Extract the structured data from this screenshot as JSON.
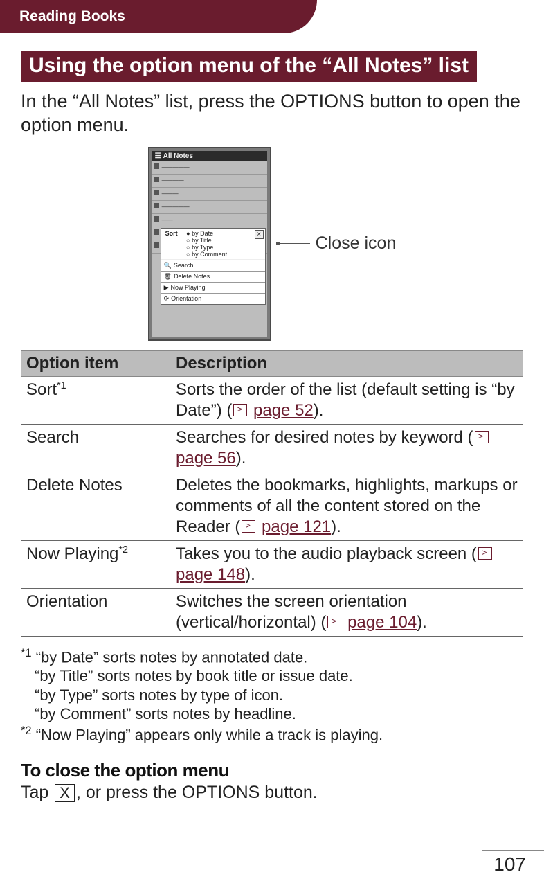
{
  "header": {
    "chapter": "Reading Books"
  },
  "section_title": "Using the option menu of the “All Notes” list",
  "intro": "In the “All Notes” list, press the OPTIONS button to open the option menu.",
  "figure": {
    "device_title": "All Notes",
    "popup_sort_label": "Sort",
    "popup_sort_options": [
      "by Date",
      "by Title",
      "by Type",
      "by Comment"
    ],
    "popup_items_below": [
      {
        "icon": "search-icon",
        "label": "Search"
      },
      {
        "icon": "trash-icon",
        "label": "Delete Notes"
      },
      {
        "icon": "play-icon",
        "label": "Now Playing"
      },
      {
        "icon": "orientation-icon",
        "label": "Orientation"
      }
    ],
    "callout_label": "Close icon"
  },
  "table": {
    "head": {
      "col1": "Option item",
      "col2": "Description"
    },
    "rows": [
      {
        "item": "Sort",
        "item_sup": "*1",
        "desc_before": "Sorts the order of the list (default setting is “by Date”) (",
        "page_link": "page 52",
        "desc_after": ")."
      },
      {
        "item": "Search",
        "item_sup": "",
        "desc_before": "Searches for desired notes by keyword (",
        "page_link": "page 56",
        "desc_after": ")."
      },
      {
        "item": "Delete Notes",
        "item_sup": "",
        "desc_before": "Deletes the bookmarks, highlights, markups or comments of all the content stored on the Reader (",
        "page_link": "page 121",
        "desc_after": ")."
      },
      {
        "item": "Now Playing",
        "item_sup": "*2",
        "desc_before": "Takes you to the audio playback screen (",
        "page_link": "page 148",
        "desc_after": ")."
      },
      {
        "item": "Orientation",
        "item_sup": "",
        "desc_before": "Switches the screen orientation (vertical/horizontal) (",
        "page_link": "page 104",
        "desc_after": ")."
      }
    ]
  },
  "footnotes": {
    "f1_mark": "*1",
    "f1_lines": [
      "“by Date” sorts notes by annotated date.",
      "“by Title” sorts notes by book title or issue date.",
      "“by Type” sorts notes by type of icon.",
      "“by Comment” sorts notes by headline."
    ],
    "f2_mark": "*2",
    "f2_line": "“Now Playing” appears only while a track is playing."
  },
  "close_section": {
    "heading": "To close the option menu",
    "before": "Tap ",
    "key": "X",
    "after": ", or press the OPTIONS button."
  },
  "page_number": "107"
}
